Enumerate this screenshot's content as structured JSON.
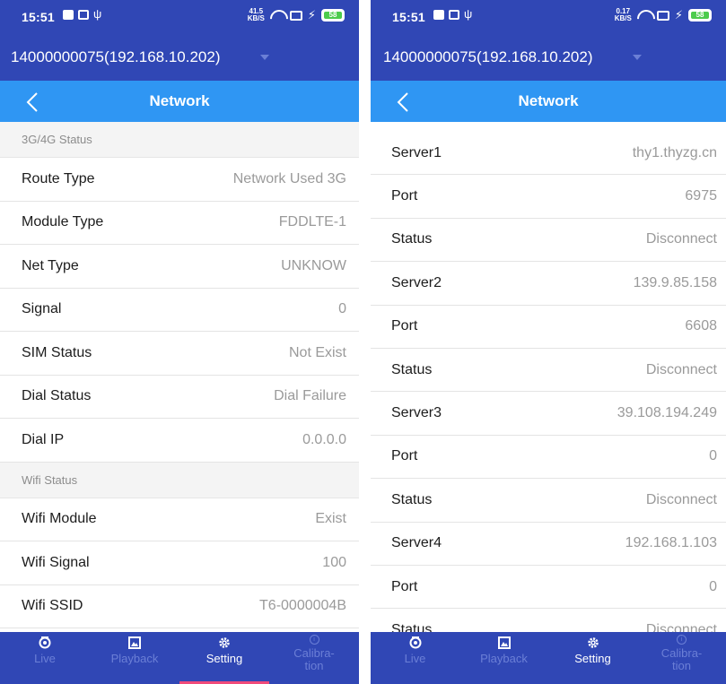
{
  "status_bar": {
    "time": "15:51",
    "left_speed": "41.5\nKB/S",
    "right_speed": "0.17\nKB/S",
    "battery": "58"
  },
  "device": {
    "name": "14000000075(192.168.10.202)"
  },
  "header": {
    "title": "Network"
  },
  "left_screen": {
    "sections": [
      {
        "title": "3G/4G Status",
        "rows": [
          {
            "label": "Route Type",
            "value": "Network Used 3G"
          },
          {
            "label": "Module Type",
            "value": "FDDLTE-1"
          },
          {
            "label": "Net Type",
            "value": "UNKNOW"
          },
          {
            "label": "Signal",
            "value": "0"
          },
          {
            "label": "SIM Status",
            "value": "Not Exist"
          },
          {
            "label": "Dial Status",
            "value": "Dial Failure"
          },
          {
            "label": "Dial IP",
            "value": "0.0.0.0"
          }
        ]
      },
      {
        "title": "Wifi Status",
        "rows": [
          {
            "label": "Wifi Module",
            "value": "Exist"
          },
          {
            "label": "Wifi Signal",
            "value": "100"
          },
          {
            "label": "Wifi SSID",
            "value": "T6-0000004B"
          }
        ]
      }
    ]
  },
  "right_screen": {
    "rows": [
      {
        "label": "Server1",
        "value": "thy1.thyzg.cn"
      },
      {
        "label": "Port",
        "value": "6975"
      },
      {
        "label": "Status",
        "value": "Disconnect"
      },
      {
        "label": "Server2",
        "value": "139.9.85.158"
      },
      {
        "label": "Port",
        "value": "6608"
      },
      {
        "label": "Status",
        "value": "Disconnect"
      },
      {
        "label": "Server3",
        "value": "39.108.194.249"
      },
      {
        "label": "Port",
        "value": "0"
      },
      {
        "label": "Status",
        "value": "Disconnect"
      },
      {
        "label": "Server4",
        "value": "192.168.1.103"
      },
      {
        "label": "Port",
        "value": "0"
      },
      {
        "label": "Status",
        "value": "Disconnect"
      }
    ]
  },
  "tabs": [
    {
      "label": "Live",
      "icon": "camera-icon",
      "active": false
    },
    {
      "label": "Playback",
      "icon": "image-icon",
      "active": false
    },
    {
      "label": "Setting",
      "icon": "gear-icon",
      "active": true
    },
    {
      "label": "Calibra-\ntion",
      "icon": "info-icon",
      "active": false
    }
  ],
  "colors": {
    "bar_dark": "#3047b5",
    "title_blue": "#2f96f3",
    "tab_inactive": "#6b7fd6",
    "tab_underline": "#f04a7a"
  }
}
